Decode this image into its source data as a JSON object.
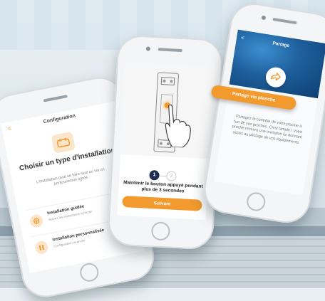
{
  "phone1": {
    "header": "Configuration",
    "back_glyph": "<",
    "title": "Choisir un type d'installation",
    "description": "L'installation peut se faire seul ou via un professionnel agréé.",
    "options": [
      {
        "title": "Installation guidée",
        "subtitle": "Suivez les instructions à l'écran",
        "selected": true
      },
      {
        "title": "Installation personnalisée",
        "subtitle": "Configuration avancée",
        "selected": false
      }
    ]
  },
  "phone2": {
    "step1": "1",
    "step2": "2",
    "instruction": "Maintenir le bouton appuyé pendant plus de 3 secondes",
    "button": "Suivant"
  },
  "phone3": {
    "back_glyph": "<",
    "title": "Partage",
    "pill": "Partage via planche",
    "description": "Partagez le contrôle de votre piscine à l'un de vos proches. C'est simple ! Votre proche recevra une invitation lui donnant accès au pilotage de vos équipements."
  },
  "colors": {
    "accent": "#f29a2e",
    "navy": "#1f2d52",
    "header_blue": "#1e5f9c"
  }
}
